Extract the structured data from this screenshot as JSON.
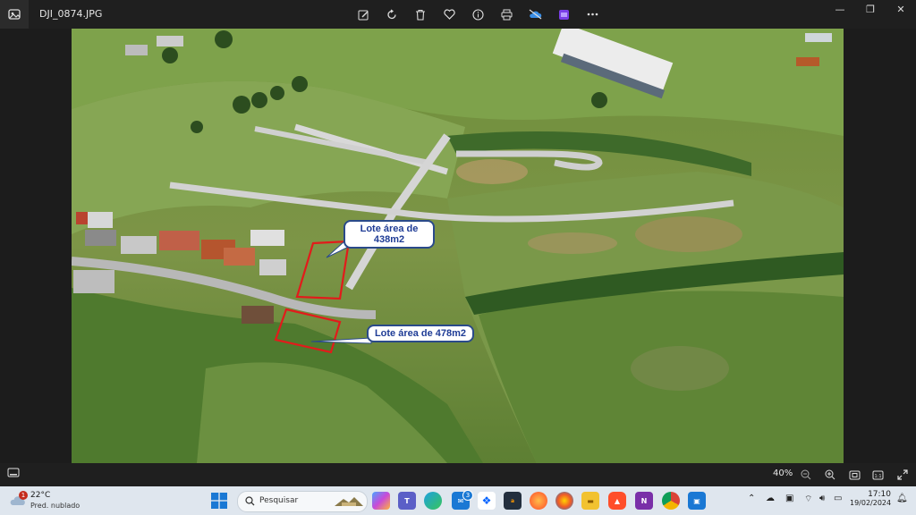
{
  "window": {
    "file_name": "DJI_0874.JPG",
    "toolbar_icons": [
      "edit-icon",
      "rotate-icon",
      "delete-icon",
      "favorite-icon",
      "info-icon",
      "print-icon",
      "cloud-off-icon",
      "clipchamp-icon",
      "more-icon"
    ],
    "controls": {
      "minimize": "—",
      "maximize": "❐",
      "close": "✕"
    }
  },
  "photo": {
    "callout_1": {
      "line1": "Lote área de",
      "line2": "438m2"
    },
    "callout_2": {
      "text": "Lote área de 478m2"
    },
    "colors": {
      "callout_text": "#1f3c96",
      "lot_outline": "#e21b1b"
    }
  },
  "bottombar": {
    "zoom": "40%"
  },
  "taskbar": {
    "weather": {
      "temp": "22°C",
      "desc": "Pred. nublado",
      "badge": "1"
    },
    "search_placeholder": "Pesquisar",
    "mail_badge": "3",
    "time": "17:10",
    "date": "19/02/2024"
  }
}
